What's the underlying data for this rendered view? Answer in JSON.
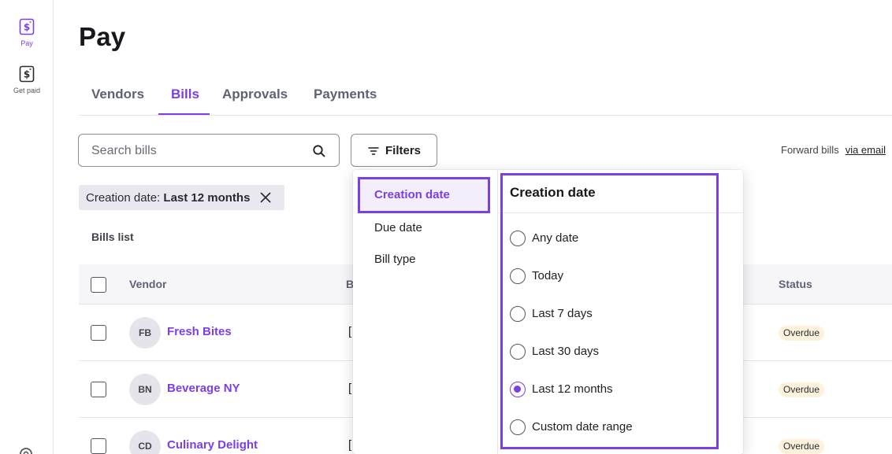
{
  "nav": {
    "items": [
      {
        "label": "Pay",
        "icon": "dollar-document-icon",
        "active": true
      },
      {
        "label": "Get paid",
        "icon": "dollar-document-icon",
        "active": false
      }
    ],
    "bottom_icon": "gear-icon"
  },
  "page": {
    "title": "Pay"
  },
  "tabs": [
    {
      "label": "Vendors",
      "active": false
    },
    {
      "label": "Bills",
      "active": true
    },
    {
      "label": "Approvals",
      "active": false
    },
    {
      "label": "Payments",
      "active": false
    }
  ],
  "search": {
    "placeholder": "Search bills",
    "icon": "search-icon"
  },
  "filters_button": {
    "label": "Filters",
    "icon": "filter-icon"
  },
  "forward": {
    "text": "Forward bills",
    "link": "via email"
  },
  "active_filter_chip": {
    "key": "Creation date:",
    "value": "Last 12 months",
    "icon": "close-icon"
  },
  "list": {
    "label": "Bills list"
  },
  "table": {
    "columns": {
      "vendor": "Vendor",
      "second": "B",
      "status": "Status"
    },
    "rows": [
      {
        "initials": "FB",
        "vendor": "Fresh Bites",
        "second": "[",
        "status": "Overdue"
      },
      {
        "initials": "BN",
        "vendor": "Beverage NY",
        "second": "[",
        "status": "Overdue"
      },
      {
        "initials": "CD",
        "vendor": "Culinary Delight",
        "second": "[",
        "status": "Overdue"
      }
    ]
  },
  "filter_menu": {
    "categories": [
      "Creation date",
      "Due date",
      "Bill type"
    ],
    "active_category": "Creation date",
    "panel_title": "Creation date",
    "options": [
      "Any date",
      "Today",
      "Last 7 days",
      "Last 30 days",
      "Last 12 months",
      "Custom date range"
    ],
    "selected_option": "Last 12 months"
  },
  "colors": {
    "accent": "#7b3fe4",
    "overdue_badge_bg": "#fdf3dc",
    "chip_bg": "#e8e8ee"
  }
}
